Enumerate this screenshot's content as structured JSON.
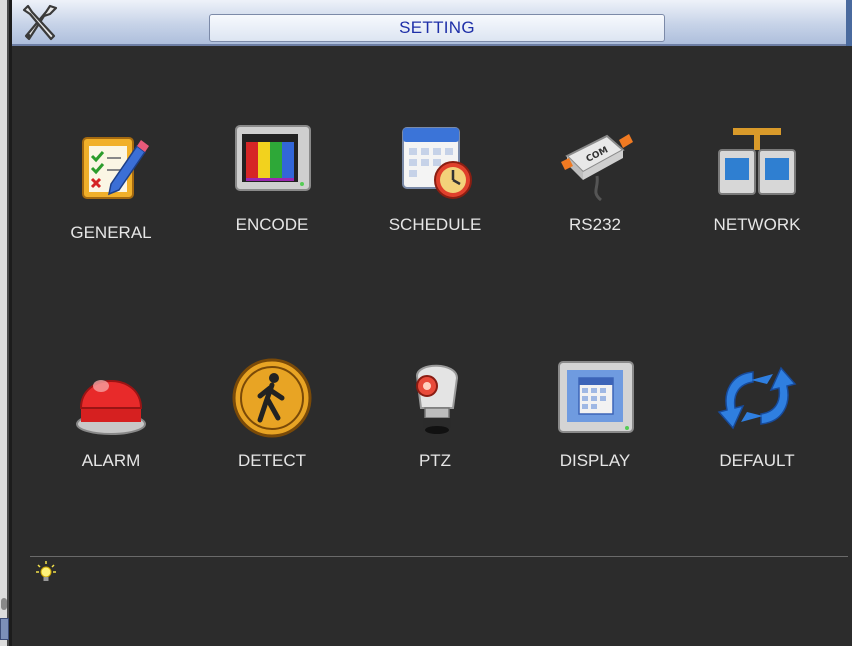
{
  "window": {
    "title": "SETTING"
  },
  "menu": {
    "items": [
      {
        "label": "GENERAL",
        "icon": "checklist-pencil-icon"
      },
      {
        "label": "ENCODE",
        "icon": "color-bars-monitor-icon"
      },
      {
        "label": "SCHEDULE",
        "icon": "calendar-clock-icon"
      },
      {
        "label": "RS232",
        "icon": "com-port-plug-icon"
      },
      {
        "label": "NETWORK",
        "icon": "network-computers-icon"
      },
      {
        "label": "ALARM",
        "icon": "red-alarm-light-icon"
      },
      {
        "label": "DETECT",
        "icon": "pedestrian-sign-icon"
      },
      {
        "label": "PTZ",
        "icon": "ptz-camera-icon"
      },
      {
        "label": "DISPLAY",
        "icon": "monitor-grid-icon"
      },
      {
        "label": "DEFAULT",
        "icon": "restore-arrows-icon"
      }
    ]
  },
  "tip": {
    "text": "",
    "icon": "lightbulb-icon"
  },
  "colors": {
    "background": "#2c2c2c",
    "title_text": "#1e2fa8",
    "label_text": "#e6e6e6"
  }
}
